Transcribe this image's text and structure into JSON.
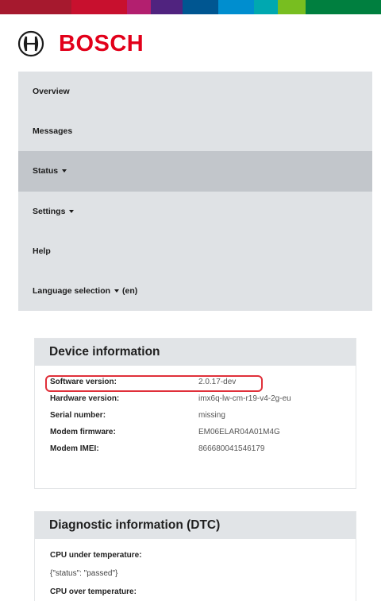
{
  "brand": {
    "name": "BOSCH",
    "logo_icon": "bosch-armature-icon",
    "strip_colors": [
      "#a6192e",
      "#c8102e",
      "#b31f6f",
      "#50237f",
      "#005691",
      "#008ecf",
      "#00a8b0",
      "#78be20",
      "#007f3f"
    ]
  },
  "nav": {
    "items": [
      {
        "label": "Overview"
      },
      {
        "label": "Messages"
      },
      {
        "label": "Status"
      },
      {
        "label": "Settings"
      },
      {
        "label": "Help"
      },
      {
        "label": "Language selection"
      }
    ],
    "language_suffix": "(en)",
    "active_item": "Status"
  },
  "device_info": {
    "title": "Device information",
    "rows": [
      {
        "label": "Software version:",
        "value": "2.0.17-dev"
      },
      {
        "label": "Hardware version:",
        "value": "imx6q-lw-cm-r19-v4-2g-eu"
      },
      {
        "label": "Serial number:",
        "value": "missing"
      },
      {
        "label": "Modem firmware:",
        "value": "EM06ELAR04A01M4G"
      },
      {
        "label": "Modem IMEI:",
        "value": "866680041546179"
      }
    ],
    "highlight_color": "#e0303a"
  },
  "dtc": {
    "title": "Diagnostic information (DTC)",
    "items": [
      {
        "label": "CPU under temperature:",
        "value": "{\"status\": \"passed\"}"
      },
      {
        "label": "CPU over temperature:",
        "value": ""
      }
    ]
  }
}
